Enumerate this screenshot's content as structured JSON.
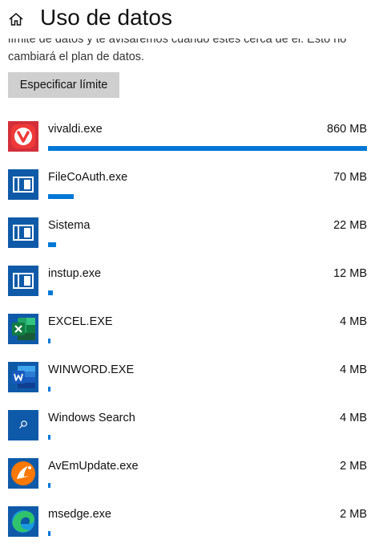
{
  "header": {
    "title": "Uso de datos",
    "home_icon": "home-icon"
  },
  "description": "límite de datos y te avisaremos cuando estés cerca de él. Esto no cambiará el plan de datos.",
  "limit_button": "Especificar límite",
  "accent": "#0078d7",
  "apps": [
    {
      "name": "vivaldi.exe",
      "usage": "860 MB",
      "fraction": 1.0,
      "icon": "vivaldi-icon"
    },
    {
      "name": "FileCoAuth.exe",
      "usage": "70 MB",
      "fraction": 0.0814,
      "icon": "app-window-icon"
    },
    {
      "name": "Sistema",
      "usage": "22 MB",
      "fraction": 0.0256,
      "icon": "app-window-icon"
    },
    {
      "name": "instup.exe",
      "usage": "12 MB",
      "fraction": 0.014,
      "icon": "app-window-icon"
    },
    {
      "name": "EXCEL.EXE",
      "usage": "4 MB",
      "fraction": 0.0047,
      "icon": "excel-icon"
    },
    {
      "name": "WINWORD.EXE",
      "usage": "4 MB",
      "fraction": 0.0047,
      "icon": "word-icon"
    },
    {
      "name": "Windows Search",
      "usage": "4 MB",
      "fraction": 0.0047,
      "icon": "search-icon"
    },
    {
      "name": "AvEmUpdate.exe",
      "usage": "2 MB",
      "fraction": 0.0023,
      "icon": "avast-icon"
    },
    {
      "name": "msedge.exe",
      "usage": "2 MB",
      "fraction": 0.0023,
      "icon": "edge-icon"
    }
  ]
}
